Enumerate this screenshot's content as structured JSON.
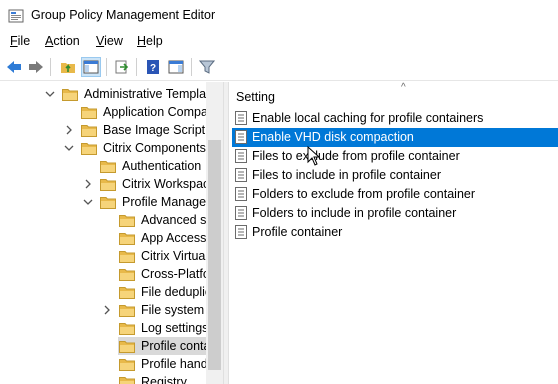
{
  "window": {
    "title": "Group Policy Management Editor"
  },
  "menu": [
    {
      "accel": "F",
      "rest": "ile"
    },
    {
      "accel": "A",
      "rest": "ction"
    },
    {
      "accel": "V",
      "rest": "iew"
    },
    {
      "accel": "H",
      "rest": "elp"
    }
  ],
  "toolbar": {
    "buttons": [
      "back-arrow",
      "forward-arrow",
      "up-folder",
      "show-hide-tree",
      "export-list",
      "help-book",
      "properties-pane",
      "filter-funnel"
    ]
  },
  "tree": {
    "items": [
      {
        "label": "Administrative Templat",
        "expander": "expanded"
      },
      {
        "label": "Application Compa",
        "expander": "none"
      },
      {
        "label": "Base Image Script F",
        "expander": "collapsed"
      },
      {
        "label": "Citrix Components",
        "expander": "expanded"
      },
      {
        "label": "Authentication",
        "expander": "none"
      },
      {
        "label": "Citrix Workspace",
        "expander": "collapsed"
      },
      {
        "label": "Profile Manager",
        "expander": "expanded"
      },
      {
        "label": "Advanced se",
        "expander": "none"
      },
      {
        "label": "App Access",
        "expander": "none"
      },
      {
        "label": "Citrix Virtual",
        "expander": "none"
      },
      {
        "label": "Cross-Platfo",
        "expander": "none"
      },
      {
        "label": "File deduplic",
        "expander": "none"
      },
      {
        "label": "File system",
        "expander": "collapsed"
      },
      {
        "label": "Log settings",
        "expander": "none"
      },
      {
        "label": "Profile conta",
        "expander": "none",
        "selected": true
      },
      {
        "label": "Profile hand",
        "expander": "none"
      },
      {
        "label": "Registry",
        "expander": "none"
      }
    ]
  },
  "settings": {
    "column_header": "Setting",
    "items": [
      {
        "label": "Enable local caching for profile containers"
      },
      {
        "label": "Enable VHD disk compaction",
        "selected": true
      },
      {
        "label": "Files to exclude from profile container"
      },
      {
        "label": "Files to include in profile container"
      },
      {
        "label": "Folders to exclude from profile container"
      },
      {
        "label": "Folders to include in profile container"
      },
      {
        "label": "Profile container"
      }
    ]
  },
  "colors": {
    "selection": "#0078d7",
    "tree_selection": "#d9d9d9",
    "folder": "#e8b94a"
  }
}
